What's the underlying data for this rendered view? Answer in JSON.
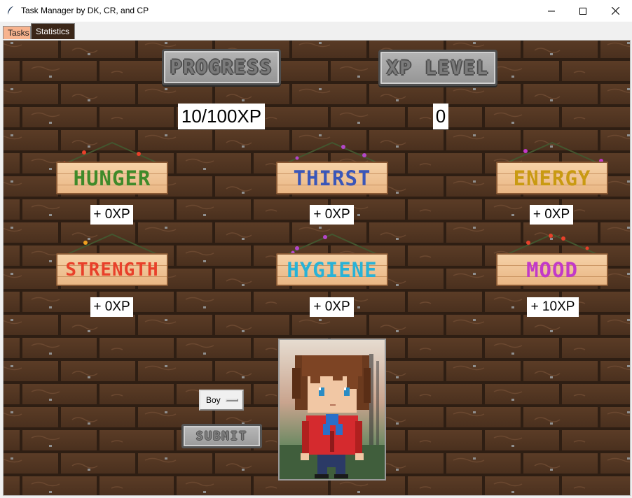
{
  "window": {
    "title": "Task Manager by DK, CR, and CP",
    "controls": [
      "minimize",
      "maximize",
      "close"
    ]
  },
  "tabs": [
    {
      "label": "Tasks",
      "color": "#f7b38e"
    },
    {
      "label": "Statistics",
      "color": "#3a2618",
      "active": true
    }
  ],
  "header": {
    "progress_title": "PROGRESS",
    "progress_value": "10/100XP",
    "xp_title": "XP LEVEL",
    "xp_level": "0"
  },
  "stats": [
    {
      "key": "hunger",
      "name": "HUNGER",
      "xp": "+ 0XP",
      "color": "#3f8a2a"
    },
    {
      "key": "thirst",
      "name": "THIRST",
      "xp": "+ 0XP",
      "color": "#3a56b8"
    },
    {
      "key": "energy",
      "name": "ENERGY",
      "xp": "+ 0XP",
      "color": "#c99a12"
    },
    {
      "key": "strength",
      "name": "STRENGTH",
      "xp": "+ 0XP",
      "color": "#e8402a"
    },
    {
      "key": "hygiene",
      "name": "HYGIENE",
      "xp": "+ 0XP",
      "color": "#29b2d6"
    },
    {
      "key": "mood",
      "name": "MOOD",
      "xp": "+ 10XP",
      "color": "#c23ac8"
    }
  ],
  "controls": {
    "character_select": "Boy",
    "submit_label": "SUBMIT"
  },
  "icons": {
    "app": "feather-icon",
    "avatar": "boy-character-sprite"
  }
}
